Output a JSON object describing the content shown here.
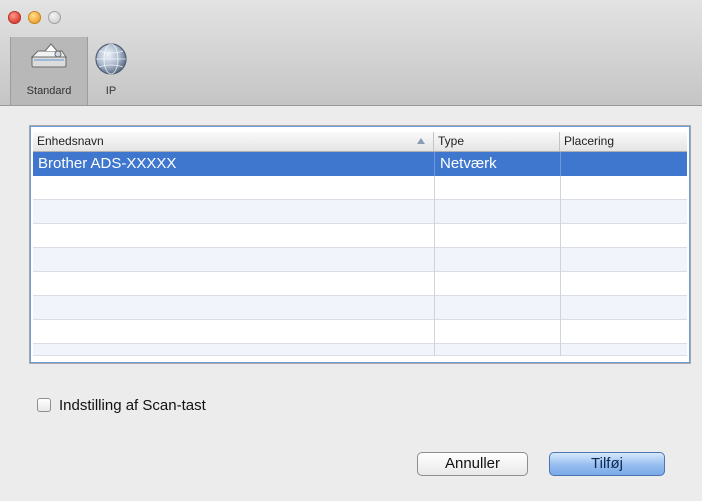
{
  "toolbar": {
    "items": [
      {
        "label": "Standard",
        "icon": "scanner-icon",
        "selected": true
      },
      {
        "label": "IP",
        "icon": "network-globe-icon",
        "selected": false
      }
    ]
  },
  "table": {
    "columns": [
      "Enhedsnavn",
      "Type",
      "Placering"
    ],
    "sort_column": "Enhedsnavn",
    "sort_direction": "ascending",
    "rows": [
      {
        "name": "Brother ADS-XXXXX",
        "type": "Netværk",
        "location": "",
        "selected": true
      }
    ]
  },
  "options": {
    "scan_key_label": "Indstilling af Scan-tast",
    "scan_key_checked": false
  },
  "buttons": {
    "cancel_label": "Annuller",
    "add_label": "Tilføj"
  },
  "colors": {
    "selection": "#3f77cf",
    "default_button": "#95bdf0"
  }
}
